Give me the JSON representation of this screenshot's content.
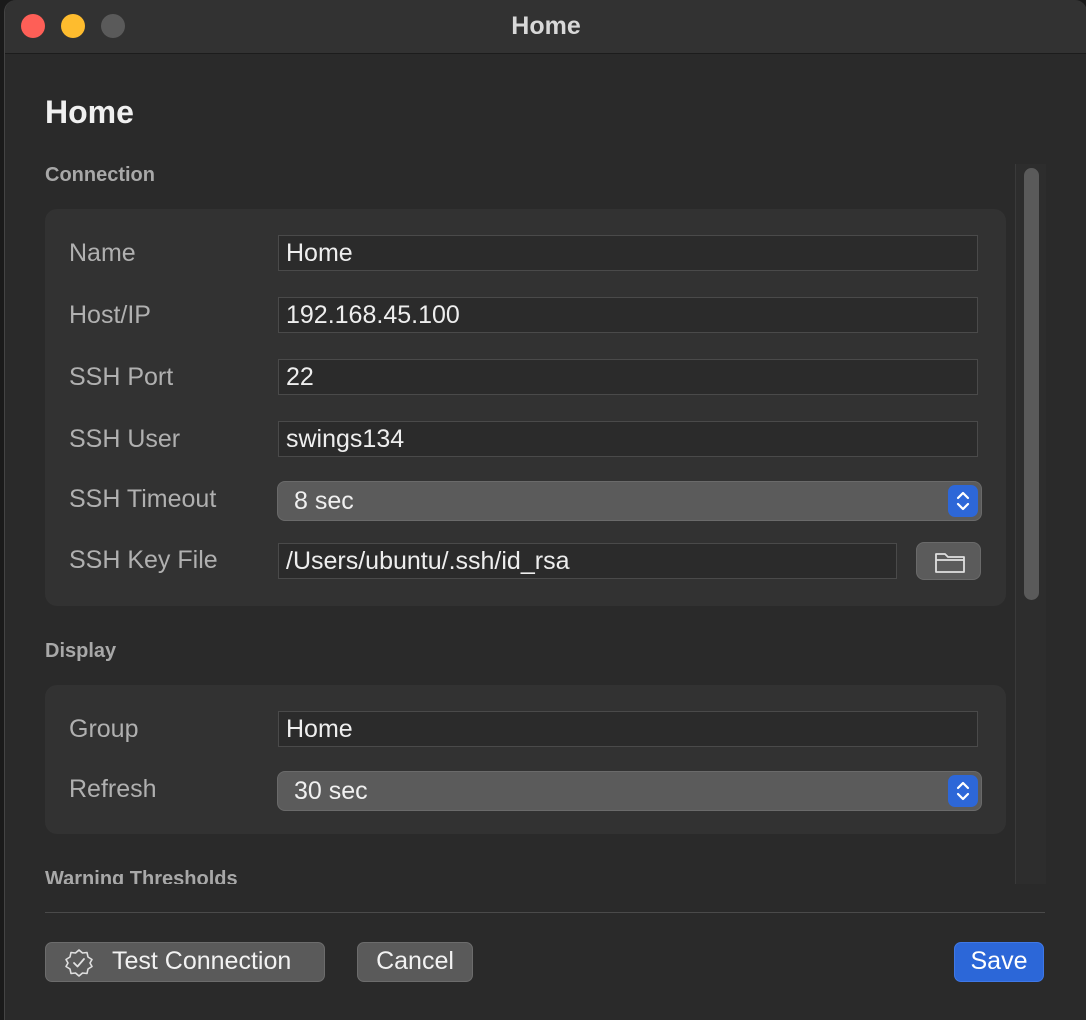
{
  "window": {
    "title": "Home"
  },
  "page": {
    "title": "Home"
  },
  "sections": {
    "connection": {
      "label": "Connection",
      "name_label": "Name",
      "name_value": "Home",
      "host_label": "Host/IP",
      "host_value": "192.168.45.100",
      "port_label": "SSH Port",
      "port_value": "22",
      "user_label": "SSH User",
      "user_value": "swings134",
      "timeout_label": "SSH Timeout",
      "timeout_value": "8 sec",
      "keyfile_label": "SSH Key File",
      "keyfile_value": "/Users/ubuntu/.ssh/id_rsa",
      "keyfile_browse_icon": "folder-icon"
    },
    "display": {
      "label": "Display",
      "group_label": "Group",
      "group_value": "Home",
      "refresh_label": "Refresh",
      "refresh_value": "30 sec"
    },
    "warning": {
      "label": "Warning Thresholds"
    }
  },
  "footer": {
    "test_label": "Test Connection",
    "test_icon": "checkmark-seal-icon",
    "cancel_label": "Cancel",
    "save_label": "Save"
  },
  "colors": {
    "accent": "#2c67d8",
    "close": "#fe5f57",
    "minimize": "#febc2e"
  }
}
